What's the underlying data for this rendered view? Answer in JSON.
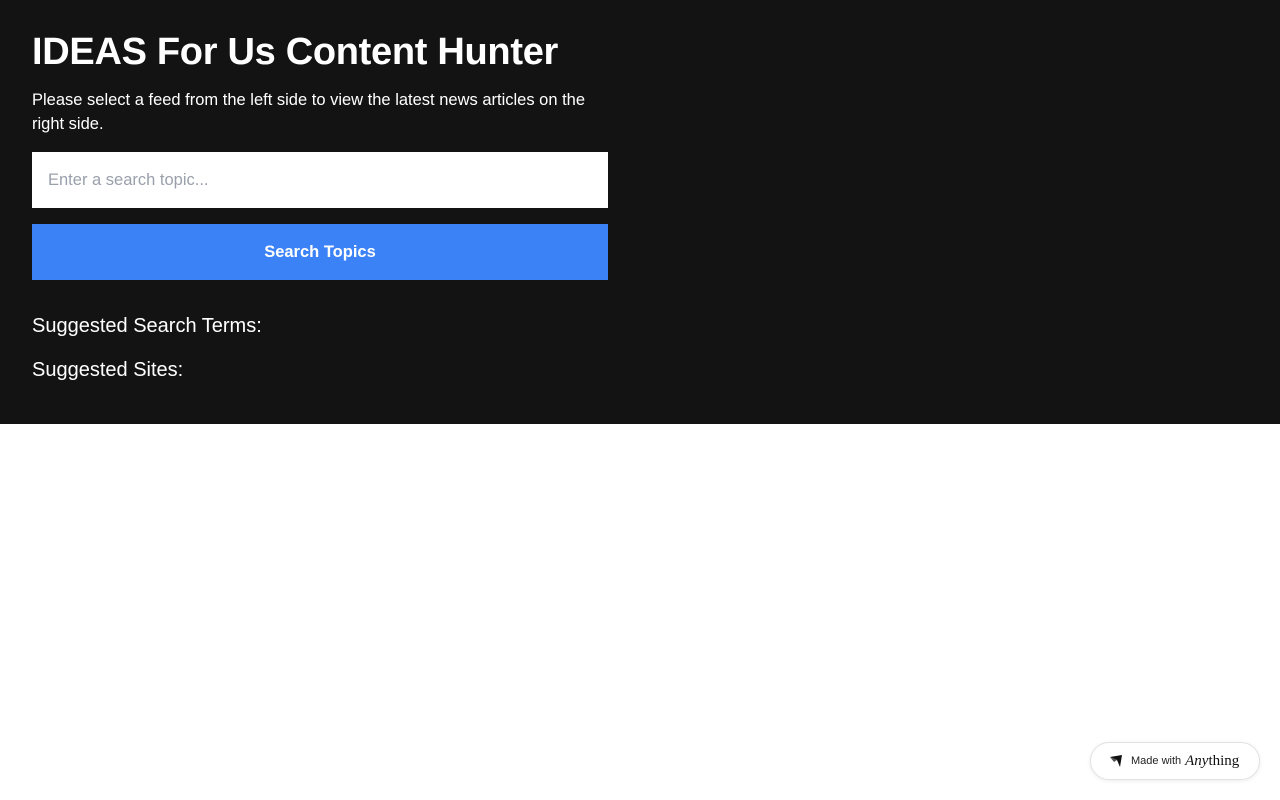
{
  "header": {
    "title": "IDEAS For Us Content Hunter",
    "description": "Please select a feed from the left side to view the latest news articles on the right side."
  },
  "search": {
    "placeholder": "Enter a search topic...",
    "value": "",
    "button_label": "Search Topics"
  },
  "sections": {
    "suggested_terms_heading": "Suggested Search Terms:",
    "suggested_sites_heading": "Suggested Sites:"
  },
  "badge": {
    "prefix": "Made with",
    "brand_italic": "Any",
    "brand_rest": "thing",
    "icon": "anything-logo-icon"
  },
  "colors": {
    "panel_background": "#131313",
    "accent": "#3b82f6",
    "page_background": "#ffffff"
  }
}
